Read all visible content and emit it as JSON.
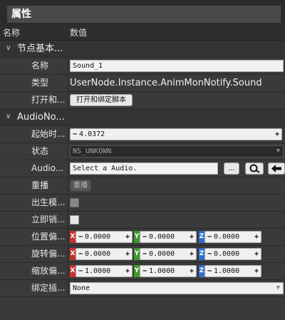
{
  "panel": {
    "title": "属性"
  },
  "columns": {
    "name": "名称",
    "value": "数值"
  },
  "groups": {
    "node_basic": {
      "title": "节点基本...",
      "arrow": "∨"
    },
    "audio_node": {
      "title": "AudioNo...",
      "arrow": "∨"
    }
  },
  "rows": {
    "name": {
      "label": "名称",
      "value": "Sound_1"
    },
    "type": {
      "label": "类型",
      "value": "UserNode.Instance.AnimMonNotify.Sound"
    },
    "open_bind": {
      "label": "打开和...",
      "button": "打开和绑定脚本"
    },
    "start_time": {
      "label": "起始时...",
      "value": "4.0372",
      "minus": "−",
      "plus": "+"
    },
    "state": {
      "label": "状态",
      "value": "NS_UNKOWN",
      "arrow": "▼"
    },
    "audio": {
      "label": "Audio...",
      "value": "Select a Audio.",
      "browse": "...",
      "search_icon": "search-icon",
      "back_icon": "arrow-left-icon"
    },
    "replay": {
      "label": "重播",
      "button": "重播"
    },
    "spawn_mode": {
      "label": "出生模...",
      "checked": false
    },
    "destroy_now": {
      "label": "立即销...",
      "checked": false
    },
    "pos_offset": {
      "label": "位置偏...",
      "x": "0.0000",
      "y": "0.0000",
      "z": "0.0000"
    },
    "rot_offset": {
      "label": "旋转偏...",
      "x": "0.0000",
      "y": "0.0000",
      "z": "0.0000"
    },
    "scale_offset": {
      "label": "缩放偏...",
      "x": "1.0000",
      "y": "1.0000",
      "z": "1.0000"
    },
    "bind_slot": {
      "label": "绑定插...",
      "value": "None",
      "arrow": "▼"
    }
  },
  "axis_labels": {
    "x": "X",
    "y": "Y",
    "z": "Z"
  },
  "spin_signs": {
    "minus": "−",
    "plus": "+"
  },
  "colors": {
    "axis_x": "#c8312b",
    "axis_y": "#3f9a2c",
    "axis_z": "#2e6fd0",
    "background": "#3a3a3a"
  }
}
